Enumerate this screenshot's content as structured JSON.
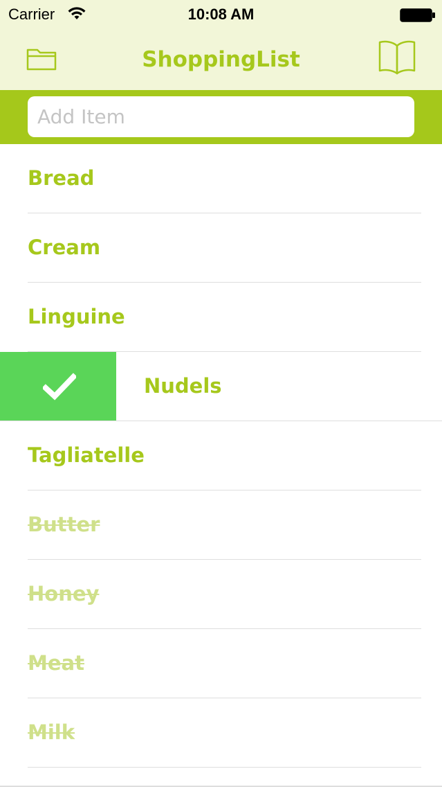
{
  "status_bar": {
    "carrier": "Carrier",
    "time": "10:08 AM",
    "wifi_icon": "wifi-icon",
    "battery_icon": "battery-icon"
  },
  "nav_bar": {
    "title": "ShoppingList",
    "left_icon": "folder-icon",
    "right_icon": "book-icon",
    "background": "#f2f6d8",
    "accent": "#a6c81c"
  },
  "add_item": {
    "placeholder": "Add Item",
    "value": "",
    "bar_color": "#a5c81b"
  },
  "items": [
    {
      "label": "Bread",
      "checked": false
    },
    {
      "label": "Cream",
      "checked": false
    },
    {
      "label": "Linguine",
      "checked": false
    },
    {
      "label": "Nudels",
      "checked": false,
      "swiped": true,
      "action_icon": "check-icon",
      "action_color": "#5ad558"
    },
    {
      "label": "Tagliatelle",
      "checked": false
    },
    {
      "label": "Butter",
      "checked": true
    },
    {
      "label": "Honey",
      "checked": true
    },
    {
      "label": "Meat",
      "checked": true
    },
    {
      "label": "Milk",
      "checked": true
    }
  ]
}
